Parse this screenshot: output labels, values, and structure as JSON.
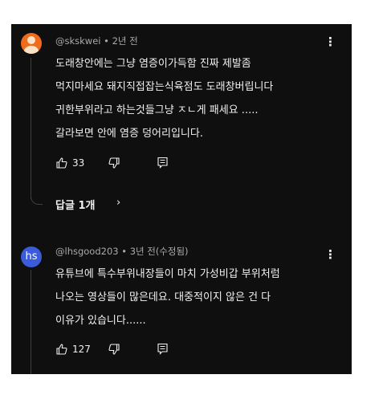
{
  "comments": [
    {
      "meta": "@skskwei • 2년 전",
      "lines": [
        "도래창안에는 그냥 염증이가득함 진짜 제발좀",
        "먹지마세요 돼지직접잡는식육점도 도래창버립니다",
        "귀한부위라고 하는것들그냥 ㅈㄴ게 패세요 .....",
        "갈라보면 안에 염증 덩어리입니다."
      ],
      "likes": "33",
      "replies": "답글 1개",
      "replies_chevron": "›",
      "more": "⋮"
    },
    {
      "avatar_text": "hs",
      "meta": "@lhsgood203 • 3년 전(수정됨)",
      "lines": [
        "유튜브에 특수부위내장들이 마치 가성비갑 부위처럼",
        "나오는 영상들이 많은데요.  대중적이지 않은 건 다",
        "이유가 있습니다......"
      ],
      "likes": "127",
      "more": "⋮"
    }
  ],
  "icons": {
    "like": "thumbs-up-icon",
    "dislike": "thumbs-down-icon",
    "reply": "reply-comment-icon"
  },
  "colors": {
    "background": "#0f0f0f",
    "text": "#f1f1f1",
    "meta": "#aaaaaa",
    "avatar_1": "#ef6c1a",
    "avatar_2": "#3b5bdb"
  }
}
